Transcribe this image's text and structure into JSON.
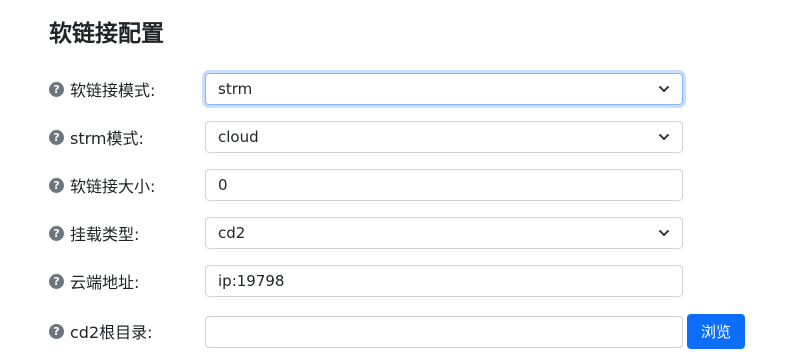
{
  "header": {
    "title": "软链接配置"
  },
  "form": {
    "fields": [
      {
        "label": "软链接模式:",
        "value": "strm",
        "type": "select"
      },
      {
        "label": "strm模式:",
        "value": "cloud",
        "type": "select"
      },
      {
        "label": "软链接大小:",
        "value": "0",
        "type": "text"
      },
      {
        "label": "挂载类型:",
        "value": "cd2",
        "type": "select"
      },
      {
        "label": "云端地址:",
        "value": "ip:19798",
        "type": "text"
      },
      {
        "label": "cd2根目录:",
        "value": "",
        "type": "text"
      }
    ],
    "help_glyph": "?",
    "browse_label": "浏览"
  },
  "icons": {
    "help": "question-circle-icon",
    "dropdown": "chevron-down-icon"
  },
  "colors": {
    "primary": "#0d6efd",
    "help_icon": "#6c757d",
    "border": "#ced4da",
    "focus_border": "#86b7fe",
    "text": "#212529"
  }
}
